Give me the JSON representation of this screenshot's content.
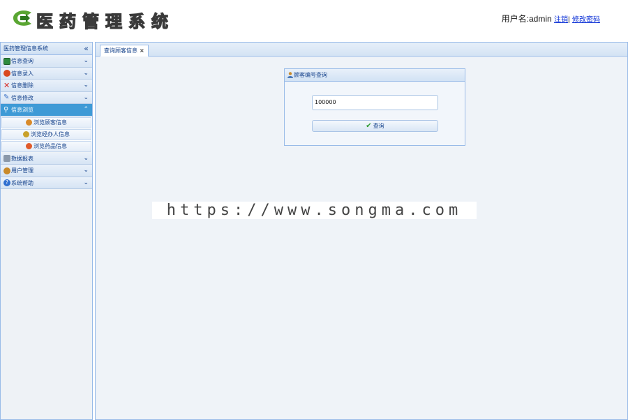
{
  "header": {
    "logo_text": "医药管理系统",
    "user_label": "用户名:admin",
    "logout_link": "注销",
    "separator": "|",
    "change_password_link": "修改密码"
  },
  "sidebar": {
    "title": "医药管理信息系统",
    "collapse_icon": "«",
    "menus": [
      {
        "label": "信息查询",
        "icon": "card-icon",
        "color": "#2e8b3e"
      },
      {
        "label": "信息录入",
        "icon": "add-icon",
        "color": "#d9481f"
      },
      {
        "label": "信息删除",
        "icon": "delete-icon",
        "color": "#d8261f"
      },
      {
        "label": "信息修改",
        "icon": "edit-icon",
        "color": "#3a6fc4"
      },
      {
        "label": "信息浏览",
        "icon": "search-icon",
        "color": "#ffffff"
      },
      {
        "label": "数据报表",
        "icon": "printer-icon",
        "color": "#6b7a8c"
      },
      {
        "label": "用户管理",
        "icon": "user-icon",
        "color": "#c98a2a"
      },
      {
        "label": "系统帮助",
        "icon": "help-icon",
        "color": "#2f6fd0"
      }
    ],
    "sub_items": [
      {
        "label": "浏览顾客信息",
        "icon": "customer-icon"
      },
      {
        "label": "浏览经办人信息",
        "icon": "agent-icon"
      },
      {
        "label": "浏览药品信息",
        "icon": "medicine-icon"
      }
    ]
  },
  "tab": {
    "label": "查询顾客信息",
    "close": "×"
  },
  "panel": {
    "title": "顾客编号查询",
    "input_value": "100000",
    "button_label": "查询"
  },
  "watermark": "https://www.songma.com",
  "colors": {
    "accent": "#3e9ad6",
    "border": "#99bbe8",
    "text_blue": "#15428b"
  }
}
